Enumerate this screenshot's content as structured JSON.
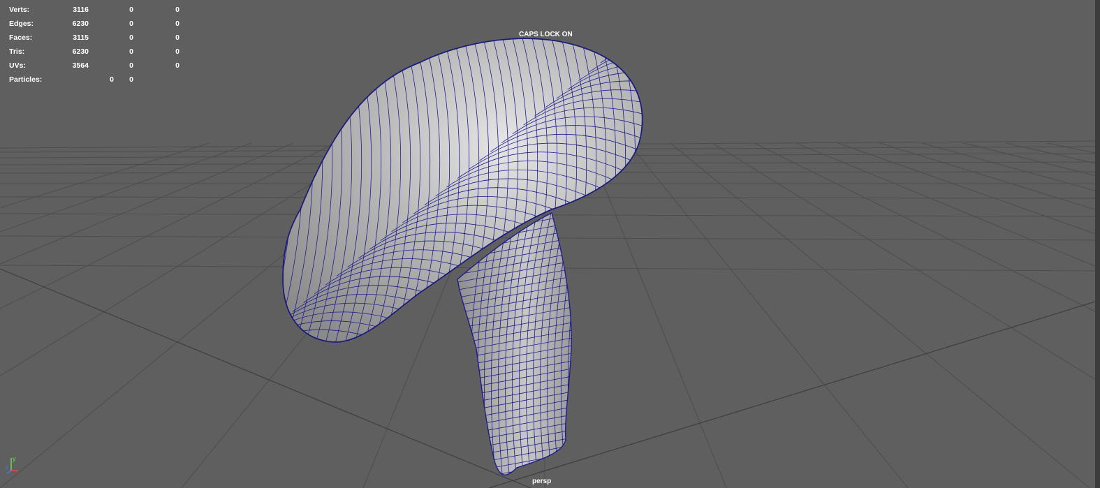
{
  "hud": {
    "rows": [
      {
        "label": "Verts:",
        "total": "3116",
        "selected": "0",
        "extra": "0"
      },
      {
        "label": "Edges:",
        "total": "6230",
        "selected": "0",
        "extra": "0"
      },
      {
        "label": "Faces:",
        "total": "3115",
        "selected": "0",
        "extra": "0"
      },
      {
        "label": "Tris:",
        "total": "6230",
        "selected": "0",
        "extra": "0"
      },
      {
        "label": "UVs:",
        "total": "3564",
        "selected": "0",
        "extra": "0"
      }
    ],
    "particles": {
      "label": "Particles:",
      "a": "0",
      "b": "0"
    }
  },
  "viewport": {
    "caps_lock": "CAPS LOCK ON",
    "camera": "persp",
    "background_color": "#5f5f5f",
    "grid_color": "#4a4a4a",
    "wire_color": "#1e1e8a"
  },
  "axis_gizmo": {
    "y_label": "y",
    "z_label": "z",
    "y_color": "#6fdc4a",
    "z_color": "#4a74e8",
    "x_color": "#e04a4a"
  }
}
